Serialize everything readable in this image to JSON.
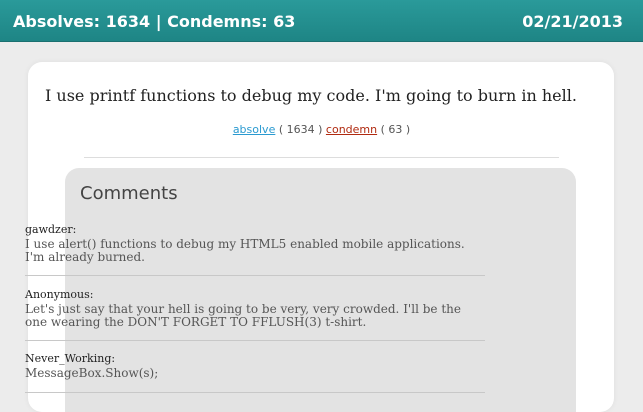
{
  "header": {
    "counts": "Absolves: 1634 | Condemns: 63",
    "date": "02/21/2013"
  },
  "confession": {
    "text": "I use printf functions to debug my code. I'm going to burn in hell."
  },
  "votes": {
    "absolve_label": "absolve",
    "absolve_count": "( 1634 )",
    "condemn_label": "condemn",
    "condemn_count": "( 63 )",
    "absolve_color": "#2a9ad0",
    "condemn_color": "#b02a10"
  },
  "comments": {
    "title": "Comments",
    "items": [
      {
        "author": "gawdzer:",
        "text": "I use alert() functions to debug my HTML5 enabled mobile applications. I'm already burned."
      },
      {
        "author": "Anonymous:",
        "text": "Let's just say that your hell is going to be very, very crowded. I'll be the one wearing the DON'T FORGET TO FFLUSH(3) t-shirt."
      },
      {
        "author": "Never_Working:",
        "text": "MessageBox.Show(s);"
      }
    ]
  },
  "colors": {
    "header": "#1e8585",
    "page_background": "#ececec",
    "comments_background": "#e3e3e3"
  }
}
